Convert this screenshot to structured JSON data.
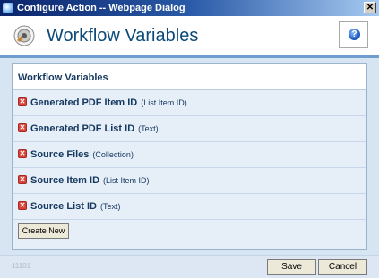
{
  "window": {
    "title": "Configure Action -- Webpage Dialog",
    "close_glyph": "✕"
  },
  "header": {
    "title": "Workflow Variables",
    "help_glyph": "?"
  },
  "panel": {
    "title": "Workflow Variables",
    "variables": [
      {
        "name": "Generated PDF Item ID",
        "type": "(List Item ID)"
      },
      {
        "name": "Generated PDF List ID",
        "type": "(Text)"
      },
      {
        "name": "Source Files",
        "type": "(Collection)"
      },
      {
        "name": "Source Item ID",
        "type": "(List Item ID)"
      },
      {
        "name": "Source List ID",
        "type": "(Text)"
      }
    ],
    "delete_glyph": "✕",
    "create_new_label": "Create New"
  },
  "footer": {
    "code": "11101",
    "save_label": "Save",
    "cancel_label": "Cancel"
  },
  "colors": {
    "titlebar_start": "#0a246a",
    "header_title": "#0a4a7a",
    "panel_text": "#14385e",
    "delete_icon": "#d9443a",
    "body_background": "#d7e4f2"
  },
  "icons": {
    "window_icon": "ie-icon",
    "header_icon": "workflow-action-icon",
    "help_icon": "help-icon",
    "delete_icon": "delete-icon"
  }
}
